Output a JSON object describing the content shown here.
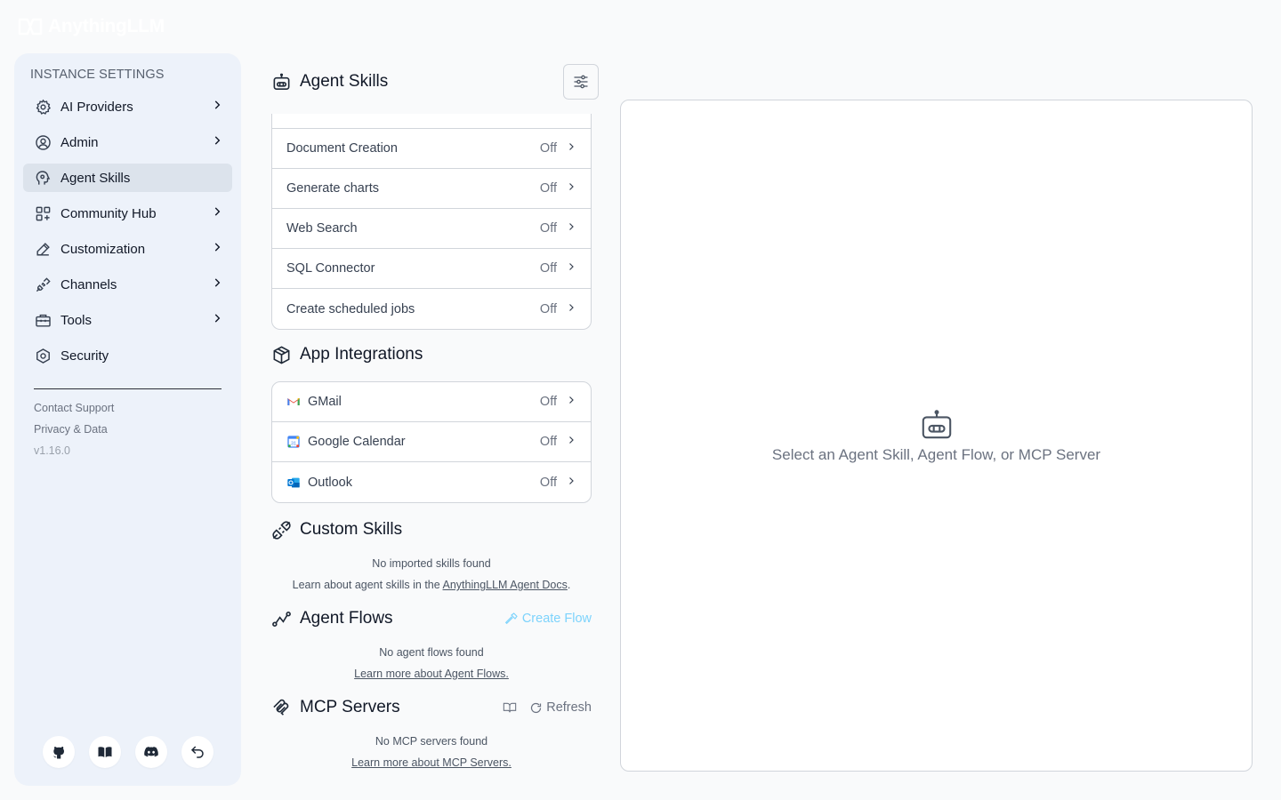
{
  "app": {
    "name": "AnythingLLM"
  },
  "sidebar": {
    "heading": "INSTANCE SETTINGS",
    "items": [
      {
        "label": "AI Providers",
        "icon": "gear-icon",
        "chevron": true
      },
      {
        "label": "Admin",
        "icon": "user-gear-icon",
        "chevron": true
      },
      {
        "label": "Agent Skills",
        "icon": "agent-head-icon",
        "chevron": false,
        "active": true
      },
      {
        "label": "Community Hub",
        "icon": "squares-icon",
        "chevron": true
      },
      {
        "label": "Customization",
        "icon": "pencil-icon",
        "chevron": true
      },
      {
        "label": "Channels",
        "icon": "plug-icon",
        "chevron": true
      },
      {
        "label": "Tools",
        "icon": "toolbox-icon",
        "chevron": true
      },
      {
        "label": "Security",
        "icon": "shield-icon",
        "chevron": false
      }
    ],
    "footer": {
      "contact": "Contact Support",
      "privacy": "Privacy & Data",
      "version": "v1.16.0"
    },
    "bottom_icons": [
      "github-icon",
      "book-icon",
      "discord-icon",
      "back-arrow-icon"
    ]
  },
  "agent_skills": {
    "title": "Agent Skills",
    "items": [
      {
        "label": "Document Creation",
        "status": "Off"
      },
      {
        "label": "Generate charts",
        "status": "Off"
      },
      {
        "label": "Web Search",
        "status": "Off"
      },
      {
        "label": "SQL Connector",
        "status": "Off"
      },
      {
        "label": "Create scheduled jobs",
        "status": "Off"
      }
    ]
  },
  "app_integrations": {
    "title": "App Integrations",
    "items": [
      {
        "label": "GMail",
        "status": "Off",
        "icon": "gmail-icon"
      },
      {
        "label": "Google Calendar",
        "status": "Off",
        "icon": "google-calendar-icon"
      },
      {
        "label": "Outlook",
        "status": "Off",
        "icon": "outlook-icon"
      }
    ]
  },
  "custom_skills": {
    "title": "Custom Skills",
    "empty": "No imported skills found",
    "learn_prefix": "Learn about agent skills in the ",
    "learn_link": "AnythingLLM Agent Docs",
    "learn_suffix": "."
  },
  "agent_flows": {
    "title": "Agent Flows",
    "create_label": "Create Flow",
    "empty": "No agent flows found",
    "learn_link": "Learn more about Agent Flows."
  },
  "mcp_servers": {
    "title": "MCP Servers",
    "refresh_label": "Refresh",
    "empty": "No MCP servers found",
    "learn_link": "Learn more about MCP Servers."
  },
  "detail": {
    "empty_message": "Select an Agent Skill, Agent Flow, or MCP Server"
  },
  "colors": {
    "accent": "#7dd3fc",
    "sidebar_bg": "#edf2fa",
    "active_bg": "#dce3ec"
  }
}
